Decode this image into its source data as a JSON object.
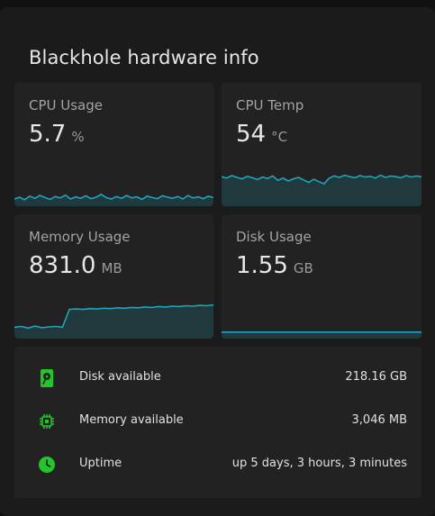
{
  "card": {
    "title": "Blackhole hardware info"
  },
  "accent_color": "#1ea4bd",
  "icon_color": "#22c52a",
  "tiles": [
    {
      "name": "CPU Usage",
      "value": "5.7",
      "unit": "%",
      "series": [
        0.2,
        0.25,
        0.18,
        0.28,
        0.22,
        0.3,
        0.24,
        0.19,
        0.27,
        0.23,
        0.31,
        0.2,
        0.26,
        0.22,
        0.29,
        0.21,
        0.25,
        0.33,
        0.24,
        0.2,
        0.27,
        0.22,
        0.3,
        0.23,
        0.26,
        0.19,
        0.28,
        0.24,
        0.21,
        0.29,
        0.25,
        0.22,
        0.27,
        0.2,
        0.3,
        0.23,
        0.26,
        0.21,
        0.28,
        0.24
      ]
    },
    {
      "name": "CPU Temp",
      "value": "54",
      "unit": "°C",
      "series": [
        0.82,
        0.78,
        0.85,
        0.8,
        0.76,
        0.83,
        0.79,
        0.74,
        0.81,
        0.77,
        0.84,
        0.72,
        0.78,
        0.7,
        0.76,
        0.8,
        0.73,
        0.66,
        0.75,
        0.68,
        0.62,
        0.78,
        0.84,
        0.8,
        0.86,
        0.82,
        0.79,
        0.85,
        0.81,
        0.83,
        0.78,
        0.86,
        0.8,
        0.84,
        0.82,
        0.79,
        0.85,
        0.81,
        0.84,
        0.82
      ]
    },
    {
      "name": "Memory Usage",
      "value": "831.0",
      "unit": "MB",
      "series": [
        0.28,
        0.3,
        0.26,
        0.31,
        0.27,
        0.29,
        0.3,
        0.28,
        0.72,
        0.73,
        0.72,
        0.74,
        0.73,
        0.75,
        0.74,
        0.76,
        0.75,
        0.77,
        0.76,
        0.78,
        0.77,
        0.79,
        0.78,
        0.8,
        0.79,
        0.81,
        0.8,
        0.82,
        0.81,
        0.83
      ]
    },
    {
      "name": "Disk Usage",
      "value": "1.55",
      "unit": "GB",
      "series": [
        0.18,
        0.18,
        0.18,
        0.18,
        0.18,
        0.18,
        0.18,
        0.18,
        0.18,
        0.18,
        0.18,
        0.18
      ]
    }
  ],
  "info": [
    {
      "icon": "harddisk-icon",
      "label": "Disk available",
      "value": "218.16 GB"
    },
    {
      "icon": "memory-chip-icon",
      "label": "Memory available",
      "value": "3,046 MB"
    },
    {
      "icon": "clock-icon",
      "label": "Uptime",
      "value": "up 5 days, 3 hours, 3 minutes"
    }
  ]
}
